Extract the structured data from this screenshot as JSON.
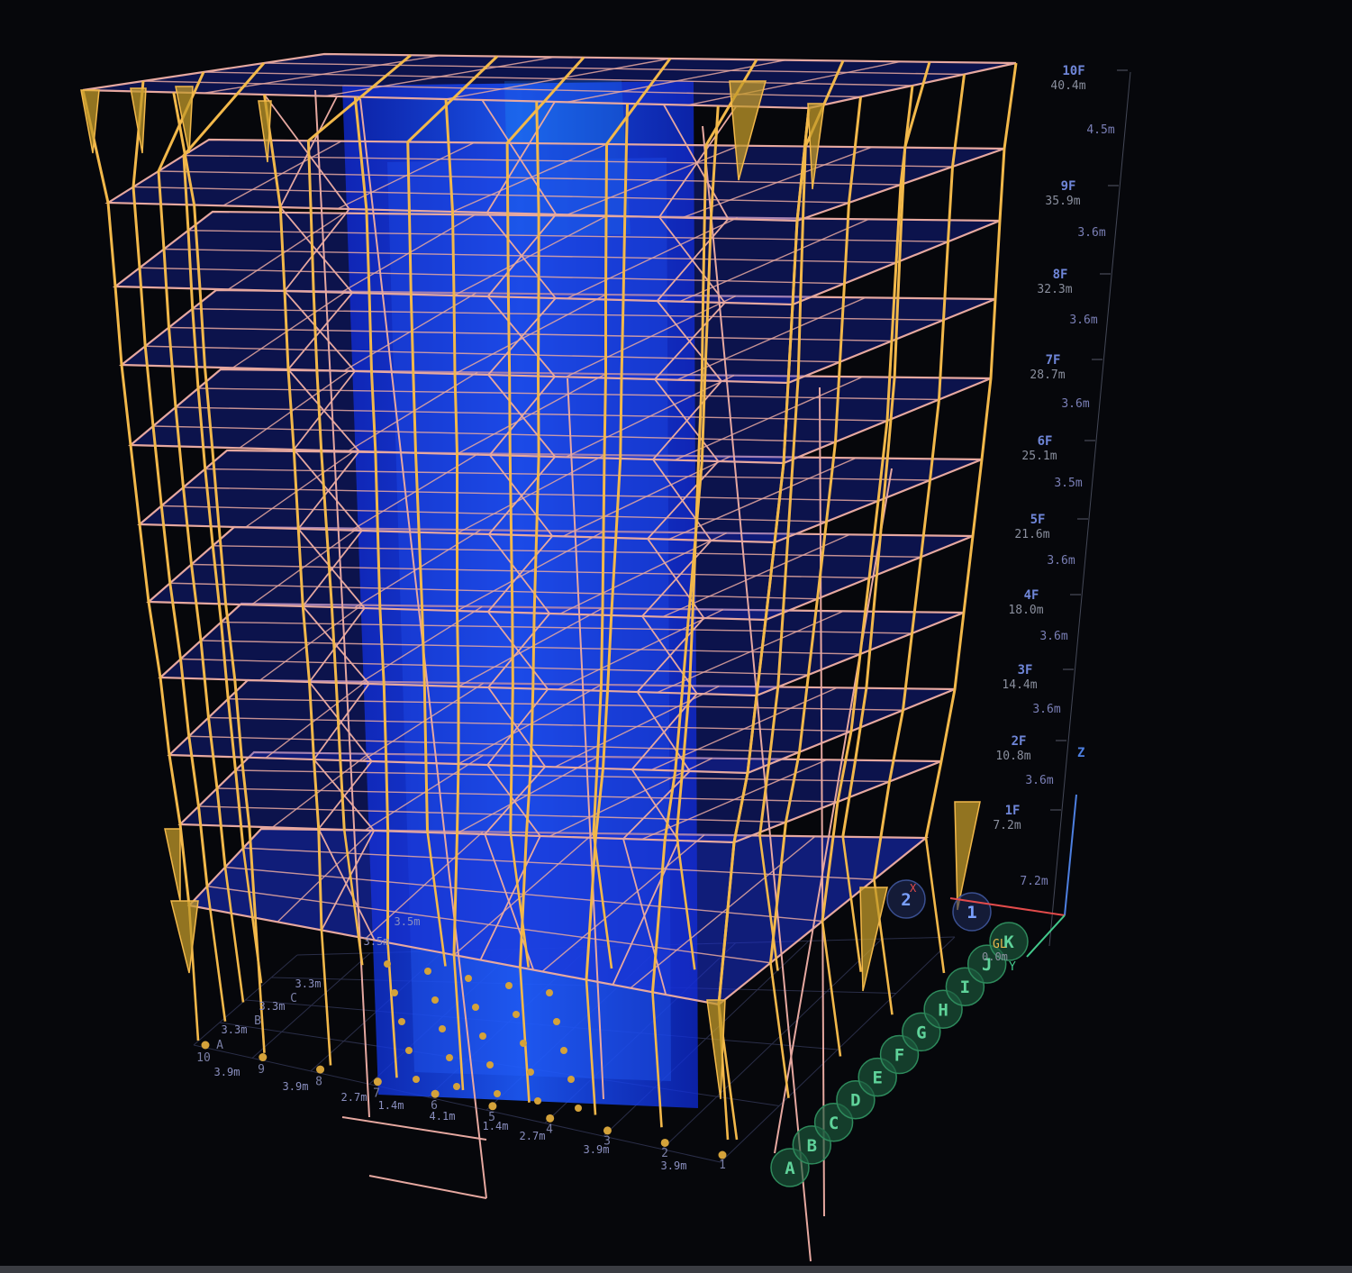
{
  "floors": [
    {
      "name": "10F",
      "elev": "40.4m",
      "height": "4.5m"
    },
    {
      "name": "9F",
      "elev": "35.9m",
      "height": "3.6m"
    },
    {
      "name": "8F",
      "elev": "32.3m",
      "height": "3.6m"
    },
    {
      "name": "7F",
      "elev": "28.7m",
      "height": "3.6m"
    },
    {
      "name": "6F",
      "elev": "25.1m",
      "height": "3.5m"
    },
    {
      "name": "5F",
      "elev": "21.6m",
      "height": "3.6m"
    },
    {
      "name": "4F",
      "elev": "18.0m",
      "height": "3.6m"
    },
    {
      "name": "3F",
      "elev": "14.4m",
      "height": "3.6m"
    },
    {
      "name": "2F",
      "elev": "10.8m",
      "height": "3.6m"
    },
    {
      "name": "1F",
      "elev": "7.2m",
      "height": "7.2m"
    }
  ],
  "axis_labels": {
    "z": "Z",
    "x": "X",
    "y": "Y"
  },
  "ground": {
    "label": "GL",
    "elev": "0.0m"
  },
  "grid_bubbles_letters": [
    "A",
    "B",
    "C",
    "D",
    "E",
    "F",
    "G",
    "H",
    "I",
    "J",
    "K"
  ],
  "grid_bubbles_numbers": [
    "1",
    "2"
  ],
  "bottom_spans": [
    {
      "label": "3.9m"
    },
    {
      "label": "3.9m"
    },
    {
      "label": "2.7m"
    },
    {
      "label": "1.4m"
    },
    {
      "label": "4.1m"
    },
    {
      "label": "1.4m"
    },
    {
      "label": "2.7m"
    },
    {
      "label": "3.9m"
    },
    {
      "label": "3.9m"
    }
  ],
  "bottom_grid_numbers": [
    "10",
    "9",
    "8",
    "7",
    "6",
    "5",
    "4",
    "3",
    "2",
    "1"
  ],
  "left_spans": [
    {
      "label": "3.3m"
    },
    {
      "label": "3.3m"
    },
    {
      "label": "3.3m"
    }
  ],
  "left_grid_letters": [
    "A",
    "B",
    "C"
  ],
  "interior_labels": [
    {
      "label": "3.5m"
    },
    {
      "label": "3.5m"
    }
  ],
  "colors": {
    "background": "#06070b",
    "column": "#f2b84a",
    "beam": "#e6a8a0",
    "slab": "#1a2fd6",
    "core": "#1f4dff",
    "bubble": "#1c5a3e",
    "axis_x": "#e24b4b",
    "axis_y": "#43c98c",
    "axis_z": "#4d7fe0"
  }
}
